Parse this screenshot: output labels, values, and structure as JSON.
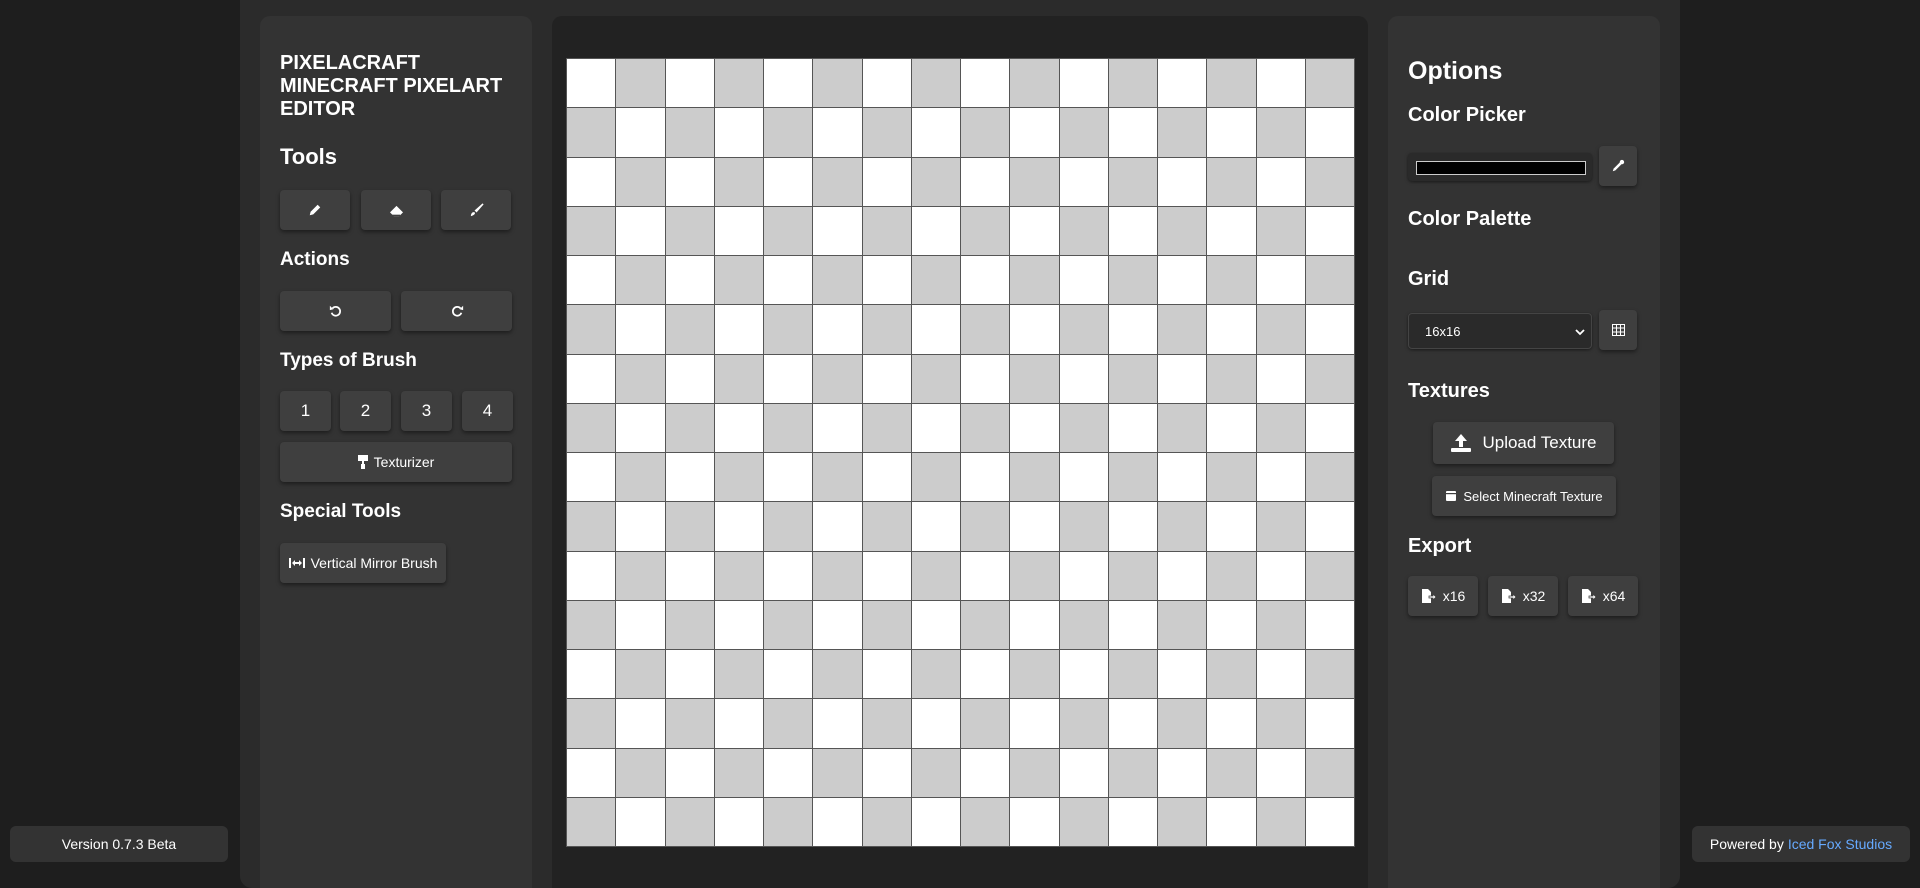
{
  "app": {
    "title": "PIXELACRAFT MINECRAFT PIXELART EDITOR"
  },
  "left": {
    "tools_heading": "Tools",
    "tools": [
      {
        "name": "pencil",
        "icon": "pencil-icon"
      },
      {
        "name": "eraser",
        "icon": "eraser-icon"
      },
      {
        "name": "brush",
        "icon": "brush-icon"
      }
    ],
    "actions_heading": "Actions",
    "actions": [
      {
        "name": "undo",
        "icon": "undo-icon"
      },
      {
        "name": "redo",
        "icon": "redo-icon"
      }
    ],
    "brush_heading": "Types of Brush",
    "brush_types": [
      "1",
      "2",
      "3",
      "4"
    ],
    "texturizer_label": "Texturizer",
    "special_heading": "Special Tools",
    "mirror_label": "Vertical Mirror Brush"
  },
  "canvas": {
    "columns": 16,
    "rows": 16,
    "colors": {
      "light": "#ffffff",
      "dark": "#cccccc",
      "grid": "#555555"
    }
  },
  "right": {
    "options_heading": "Options",
    "color_picker_heading": "Color Picker",
    "current_color": "#000000",
    "palette_heading": "Color Palette",
    "grid_heading": "Grid",
    "grid_selected": "16x16",
    "textures_heading": "Textures",
    "upload_label": "Upload Texture",
    "select_texture_label": "Select Minecraft Texture",
    "export_heading": "Export",
    "export_options": [
      "x16",
      "x32",
      "x64"
    ]
  },
  "footer": {
    "version": "Version 0.7.3 Beta",
    "powered_prefix": "Powered by",
    "powered_link": "Iced Fox Studios"
  },
  "colors": {
    "link": "#66aaff"
  }
}
